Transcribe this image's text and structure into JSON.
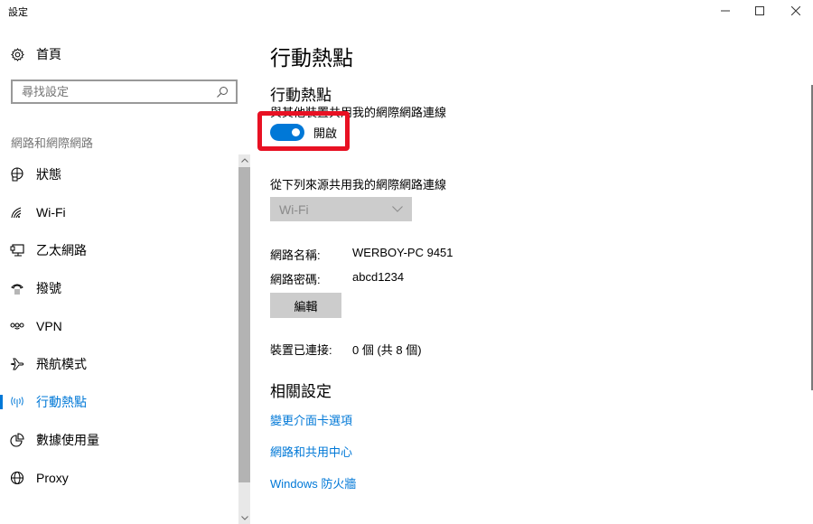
{
  "window": {
    "title": "設定",
    "minimize_icon": "minimize-icon",
    "maximize_icon": "maximize-icon",
    "close_icon": "close-icon"
  },
  "sidebar": {
    "home": {
      "label": "首頁",
      "icon": "gear-icon"
    },
    "search": {
      "placeholder": "尋找設定",
      "value": "",
      "icon": "search-icon"
    },
    "section_label": "網路和網際網路",
    "items": [
      {
        "label": "狀態",
        "icon": "globe-status-icon",
        "active": false
      },
      {
        "label": "Wi-Fi",
        "icon": "wifi-icon",
        "active": false
      },
      {
        "label": "乙太網路",
        "icon": "ethernet-icon",
        "active": false
      },
      {
        "label": "撥號",
        "icon": "dialup-icon",
        "active": false
      },
      {
        "label": "VPN",
        "icon": "vpn-icon",
        "active": false
      },
      {
        "label": "飛航模式",
        "icon": "airplane-icon",
        "active": false
      },
      {
        "label": "行動熱點",
        "icon": "hotspot-icon",
        "active": true
      },
      {
        "label": "數據使用量",
        "icon": "data-usage-icon",
        "active": false
      },
      {
        "label": "Proxy",
        "icon": "globe-icon",
        "active": false
      }
    ]
  },
  "main": {
    "page_title": "行動熱點",
    "hotspot": {
      "title": "行動熱點",
      "description": "與其他裝置共用我的網際網路連線",
      "toggle_state": "on",
      "toggle_label": "開啟"
    },
    "source": {
      "label": "從下列來源共用我的網際網路連線",
      "selected": "Wi-Fi"
    },
    "network_name": {
      "key": "網路名稱:",
      "value": "WERBOY-PC 9451"
    },
    "network_password": {
      "key": "網路密碼:",
      "value": "abcd1234"
    },
    "edit_label": "編輯",
    "devices_connected": {
      "key": "裝置已連接:",
      "value": "0 個 (共 8 個)"
    },
    "related": {
      "title": "相關設定",
      "links": [
        "變更介面卡選項",
        "網路和共用中心",
        "Windows 防火牆"
      ]
    }
  },
  "colors": {
    "accent": "#0078d7",
    "highlight": "#e81123"
  }
}
